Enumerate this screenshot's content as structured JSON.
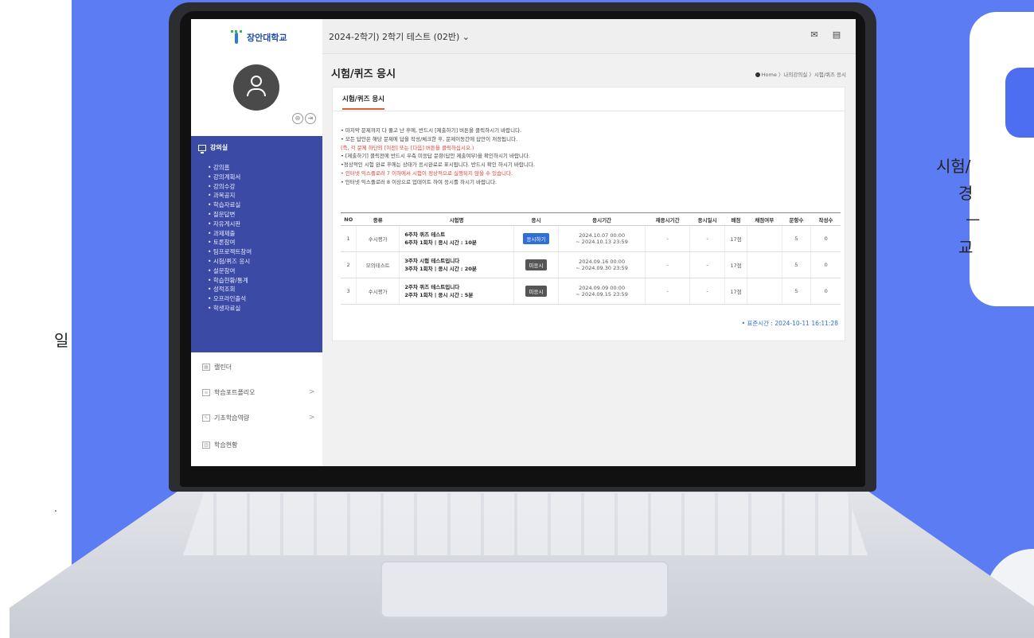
{
  "left_fragments": [
    "일",
    "."
  ],
  "right_card": {
    "lines": [
      "시험/",
      "경",
      "ㅡ",
      "교"
    ]
  },
  "sidebar": {
    "logo": "장안대학교",
    "mini_icons": [
      "lock-icon",
      "logout-icon"
    ],
    "nav_header": "강의실",
    "nav_items": [
      "강의홈",
      "강의계획서",
      "강의수강",
      "과목공지",
      "학습자료실",
      "질문답변",
      "자유게시판",
      "과제제출",
      "토론참여",
      "팀프로젝트참여",
      "시험/퀴즈 응시",
      "설문참여",
      "학습현황/통계",
      "성적조회",
      "오프라인출석",
      "학생자료실"
    ],
    "sections": [
      {
        "label": "캘린더",
        "icon": "calendar-icon",
        "chevron": ""
      },
      {
        "label": "학습포트폴리오",
        "icon": "list-icon",
        "chevron": ">"
      },
      {
        "label": "기초학습역량",
        "icon": "edit-icon",
        "chevron": ">"
      },
      {
        "label": "학습현황",
        "icon": "bar-chart-icon",
        "chevron": ""
      }
    ]
  },
  "topbar": {
    "course": "2024-2학기) 2학기 테스트 (02반) ⌄",
    "icons": [
      "mail-icon",
      "notice-icon"
    ]
  },
  "page": {
    "title": "시험/퀴즈 응시",
    "breadcrumb": "Home 〉나의강의실 〉시험/퀴즈 응시"
  },
  "panel": {
    "tab": "시험/퀴즈 응시",
    "notes": [
      {
        "text": "• 마지막 문제까지 다 풀고 난 후에, 반드시 [제출하기] 버튼을 클릭하시기 바랍니다.",
        "red": false
      },
      {
        "text": "• 모든 답안은 해당 문제에 답을 작성/체크한 후, 문제이동간에 답안이 저장됩니다.",
        "red": false
      },
      {
        "text": "(즉, 각 문제 하단의 [이전] 또는 [다음] 버튼을 클릭하십시오.)",
        "red": true
      },
      {
        "text": "• [제출하기] 클릭전에 반드시 우측 미응답 문항(답안 제출여부)을 확인하시기 바랍니다.",
        "red": false
      },
      {
        "text": "•정상적인 시험 완료 후에는 상태가 응시완료로 표시됩니다. 반드시 확인 하시기 바랍니다.",
        "red": false
      },
      {
        "text": "• 인터넷 익스플로러 7 이하에서 시험이 정상적으로 실행되지 않을 수 있습니다.",
        "red": true
      },
      {
        "text": "• 인터넷 익스플로러 8 이상으로 업데이트 하여 응시를 하시기 바랍니다.",
        "red": false
      }
    ],
    "table": {
      "headers": [
        "NO",
        "종류",
        "시험명",
        "응시",
        "응시기간",
        "재응시기간",
        "응시일시",
        "배점",
        "채점여부",
        "문항수",
        "작성수"
      ],
      "rows": [
        {
          "no": "1",
          "type": "수시평가",
          "name1": "6주차 퀴즈 테스트",
          "name2": "6주차 1회차 | 응시 시간 : 10분",
          "status": "응시하기",
          "status_kind": "take",
          "period1": "2024.10.07 00:00",
          "period2": "~ 2024.10.13 23:59",
          "retake": "-",
          "taken": "-",
          "score": "17점",
          "graded": "",
          "items": "5",
          "written": "0"
        },
        {
          "no": "2",
          "type": "모의테스트",
          "name1": "3주차 시험 테스트입니다",
          "name2": "3주차 1회차 | 응시 시간 : 20분",
          "status": "미응시",
          "status_kind": "no",
          "period1": "2024.09.16 00:00",
          "period2": "~ 2024.09.30 23:59",
          "retake": "-",
          "taken": "-",
          "score": "17점",
          "graded": "",
          "items": "5",
          "written": "0"
        },
        {
          "no": "3",
          "type": "수시평가",
          "name1": "2주차 퀴즈 테스트입니다",
          "name2": "2주차 1회차 | 응시 시간 : 5분",
          "status": "미응시",
          "status_kind": "no",
          "period1": "2024.09.09 00:00",
          "period2": "~ 2024.09.15 23:59",
          "retake": "-",
          "taken": "-",
          "score": "17점",
          "graded": "",
          "items": "5",
          "written": "0"
        }
      ]
    },
    "server_time": "• 표준시간 : 2024-10-11 16:11:28"
  }
}
